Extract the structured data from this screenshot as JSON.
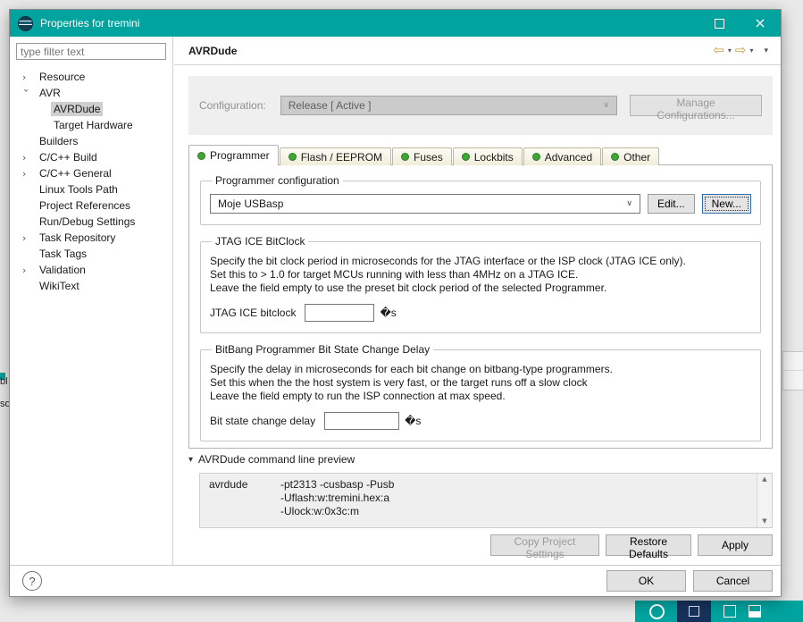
{
  "window": {
    "title": "Properties for tremini"
  },
  "colors": {
    "titlebar": "#00a39e",
    "taskbar": "#00a39e",
    "tree_selection": "#cfcfcf",
    "tab_icon_green": "#3fa535",
    "disabled_panel": "#efefef"
  },
  "glyphs": {
    "chevron": "›",
    "back_arrow": "⇦",
    "forward_arrow": "⇨",
    "dropdown_caret": "▾",
    "combo_arrow": "∨",
    "twistie": "▾",
    "scroll_up": "▲",
    "scroll_down": "▼",
    "close": "×",
    "help": "?"
  },
  "sidebar": {
    "filter_placeholder": "type filter text",
    "tree": [
      {
        "label": "Resource"
      },
      {
        "label": "AVR"
      },
      {
        "label": "AVRDude"
      },
      {
        "label": "Target Hardware"
      },
      {
        "label": "Builders"
      },
      {
        "label": "C/C++ Build"
      },
      {
        "label": "C/C++ General"
      },
      {
        "label": "Linux Tools Path"
      },
      {
        "label": "Project References"
      },
      {
        "label": "Run/Debug Settings"
      },
      {
        "label": "Task Repository"
      },
      {
        "label": "Task Tags"
      },
      {
        "label": "Validation"
      },
      {
        "label": "WikiText"
      }
    ]
  },
  "header": {
    "title": "AVRDude"
  },
  "configuration": {
    "label": "Configuration:",
    "value": "Release  [ Active ]",
    "manage_button": "Manage Configurations..."
  },
  "tabs": [
    {
      "label": "Programmer"
    },
    {
      "label": "Flash / EEPROM"
    },
    {
      "label": "Fuses"
    },
    {
      "label": "Lockbits"
    },
    {
      "label": "Advanced"
    },
    {
      "label": "Other"
    }
  ],
  "programmer_group": {
    "title": "Programmer configuration",
    "selected": "Moje USBasp",
    "edit_button": "Edit...",
    "new_button": "New..."
  },
  "jtag_group": {
    "title": "JTAG ICE BitClock",
    "lines": [
      "Specify the bit clock period in microseconds for the JTAG interface or the ISP clock (JTAG ICE only).",
      "Set this to > 1.0 for target MCUs running with less than 4MHz on a JTAG ICE.",
      "Leave the field empty to use the preset bit clock period of the selected Programmer."
    ],
    "field_label": "JTAG ICE bitclock",
    "unit": "�s"
  },
  "bitbang_group": {
    "title": "BitBang Programmer Bit State Change Delay",
    "lines": [
      "Specify the delay in microseconds for each bit change on bitbang-type programmers.",
      "Set this when the the host system is very fast, or the target runs off a slow clock",
      "Leave the field empty to run the ISP connection at max speed."
    ],
    "field_label": "Bit state change delay",
    "unit": "�s"
  },
  "preview": {
    "title": "AVRDude command line preview",
    "command": "avrdude",
    "args": [
      "-pt2313 -cusbasp -Pusb",
      "-Uflash:w:tremini.hex:a",
      "-Ulock:w:0x3c:m"
    ]
  },
  "action_buttons": {
    "copy": "Copy Project Settings",
    "restore": "Restore Defaults",
    "apply": "Apply"
  },
  "footer": {
    "ok": "OK",
    "cancel": "Cancel"
  },
  "background": {
    "fragments": [
      "bl",
      "so"
    ]
  }
}
